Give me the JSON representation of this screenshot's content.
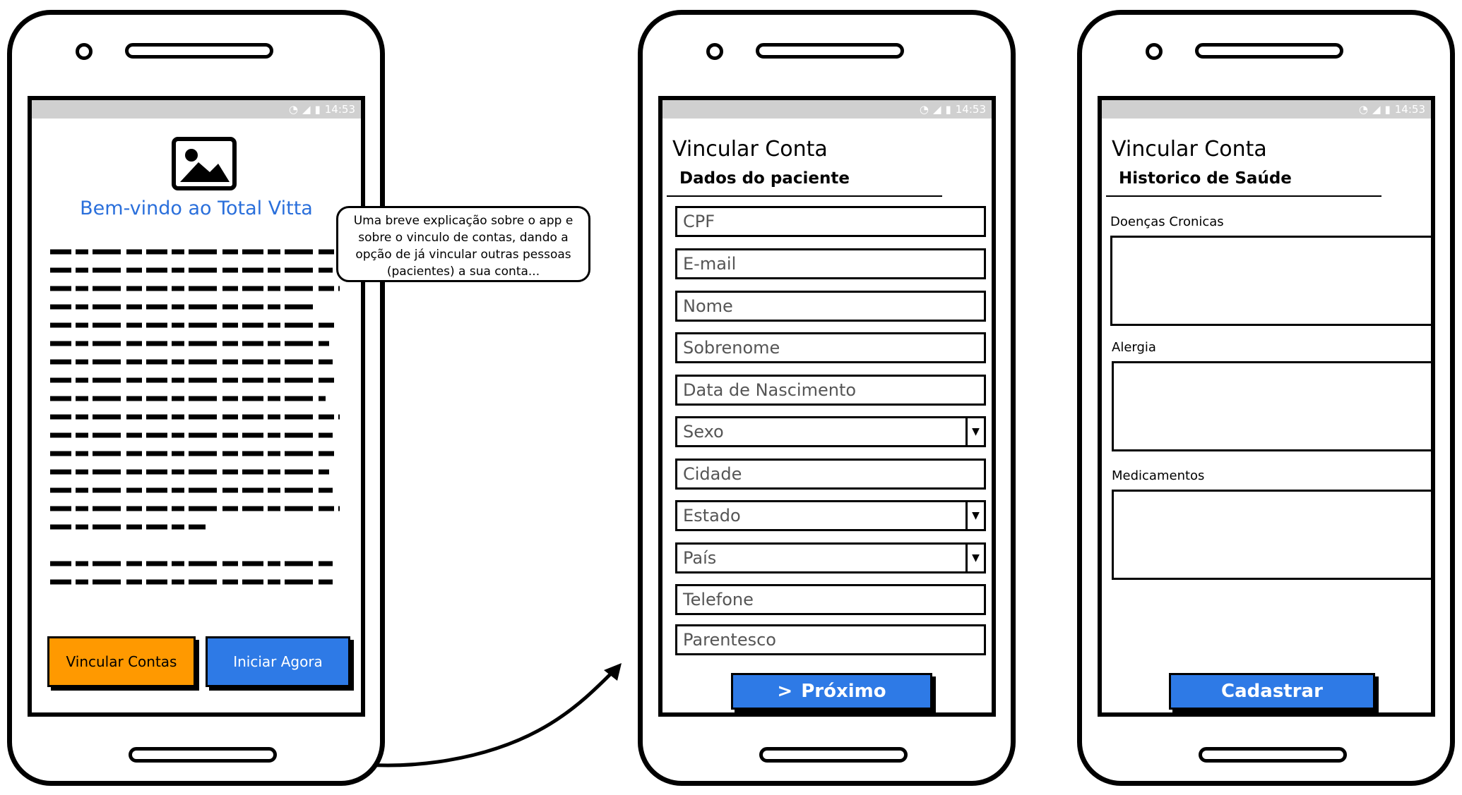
{
  "status": {
    "time": "14:53"
  },
  "screen1": {
    "welcome": "Bem-vindo ao Total Vitta",
    "image_icon": "image-placeholder-icon",
    "btn_link": "Vincular Contas",
    "btn_start": "Iniciar Agora",
    "callout": "Uma breve explicação sobre o app e sobre o vinculo de contas, dando a opção de já vincular outras pessoas (pacientes) a sua conta..."
  },
  "screen2": {
    "title": "Vincular Conta",
    "section": "Dados do paciente",
    "fields": [
      "CPF",
      "E-mail",
      "Nome",
      "Sobrenome",
      "Data de Nascimento",
      "Sexo",
      "Cidade",
      "Estado",
      "País",
      "Telefone",
      "Parentesco"
    ],
    "next_label": "Próximo"
  },
  "screen3": {
    "title": "Vincular Conta",
    "section": "Historico de Saúde",
    "label_chronic": "Doenças Cronicas",
    "label_allergy": "Alergia",
    "label_meds": "Medicamentos",
    "submit_label": "Cadastrar"
  },
  "colors": {
    "blue": "#2e7ae6",
    "orange": "#ff9900",
    "accent_text": "#2a6fdb"
  }
}
